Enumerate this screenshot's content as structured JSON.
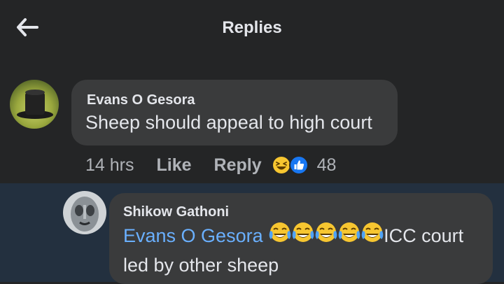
{
  "header": {
    "title": "Replies",
    "back_icon": "arrow-left-icon"
  },
  "comment": {
    "author": "Evans O Gesora",
    "text": "Sheep should appeal to high court",
    "time": "14 hrs",
    "like_label": "Like",
    "reply_label": "Reply",
    "reaction_icons": [
      "laughing-face-icon",
      "thumbs-up-icon"
    ],
    "reaction_count": "48"
  },
  "reply": {
    "author": "Shikow Gathoni",
    "mention": "Evans O Gesora",
    "emoji_icon": "tears-of-joy-emoji",
    "emoji_count": 5,
    "text_after": "ICC court",
    "text_line2": "led by other sheep"
  },
  "colors": {
    "background": "#242526",
    "bubble": "#3a3b3c",
    "highlight": "#23303f",
    "mention": "#6ab0ff",
    "like_blue": "#1877f2"
  }
}
